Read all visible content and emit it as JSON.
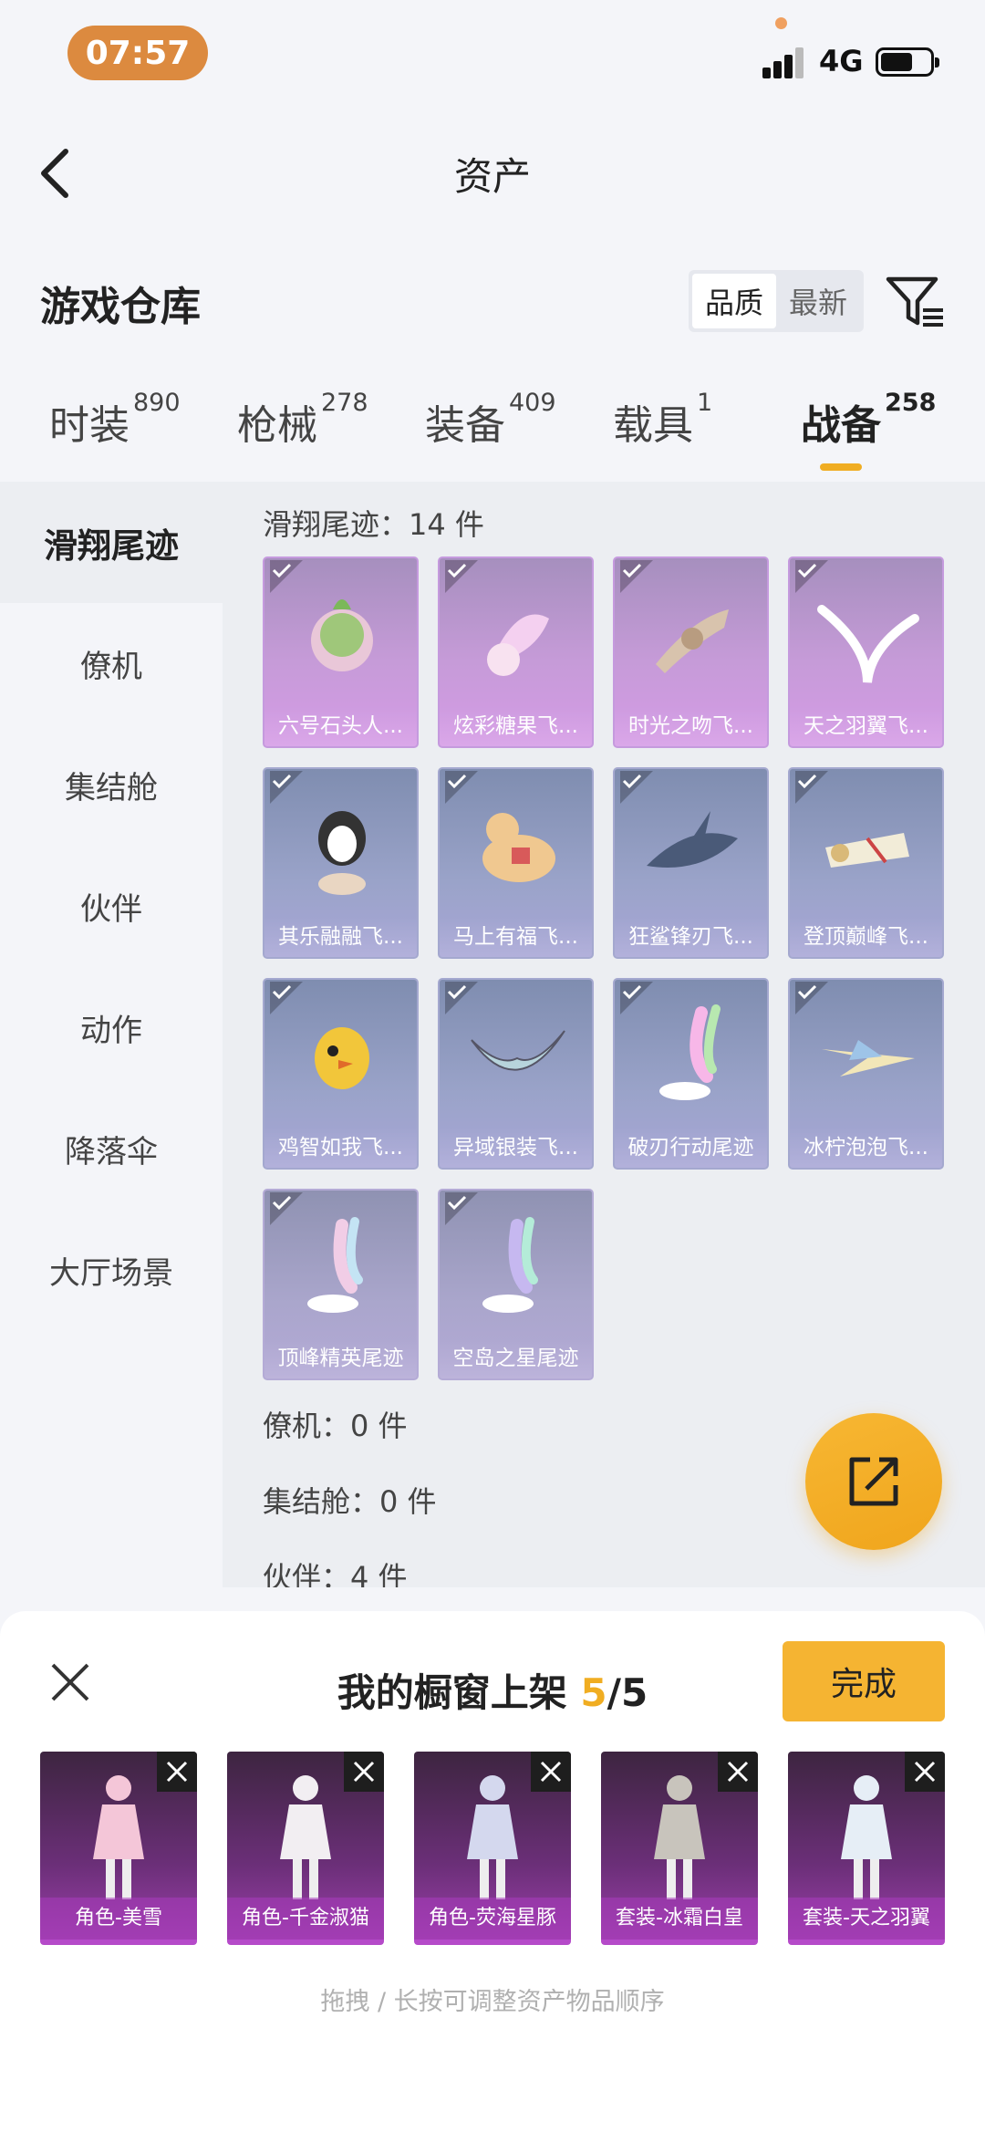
{
  "status": {
    "time": "07:57",
    "network": "4G"
  },
  "header": {
    "title": "资产"
  },
  "section": {
    "title": "游戏仓库",
    "sort_options": [
      "品质",
      "最新"
    ],
    "sort_active": 0
  },
  "tabs": [
    {
      "label": "时装",
      "count": "890"
    },
    {
      "label": "枪械",
      "count": "278"
    },
    {
      "label": "装备",
      "count": "409"
    },
    {
      "label": "载具",
      "count": "1"
    },
    {
      "label": "战备",
      "count": "258"
    }
  ],
  "active_tab": 4,
  "sidebar": {
    "items": [
      "滑翔尾迹",
      "僚机",
      "集结舱",
      "伙伴",
      "动作",
      "降落伞",
      "大厅场景"
    ],
    "active": 0
  },
  "groups": [
    {
      "title": "滑翔尾迹：14 件"
    },
    {
      "title": "僚机：0 件"
    },
    {
      "title": "集结舱：0 件"
    },
    {
      "title": "伙伴：4 件"
    }
  ],
  "items": [
    {
      "name": "六号石头人...",
      "tier": "purple"
    },
    {
      "name": "炫彩糖果飞...",
      "tier": "purple"
    },
    {
      "name": "时光之吻飞...",
      "tier": "purple"
    },
    {
      "name": "天之羽翼飞...",
      "tier": "purple"
    },
    {
      "name": "其乐融融飞...",
      "tier": "blue"
    },
    {
      "name": "马上有福飞...",
      "tier": "blue"
    },
    {
      "name": "狂鲨锋刃飞...",
      "tier": "blue"
    },
    {
      "name": "登顶巅峰飞...",
      "tier": "blue"
    },
    {
      "name": "鸡智如我飞...",
      "tier": "blue"
    },
    {
      "name": "异域银装飞...",
      "tier": "blue"
    },
    {
      "name": "破刃行动尾迹",
      "tier": "blue"
    },
    {
      "name": "冰柠泡泡飞...",
      "tier": "blue"
    },
    {
      "name": "顶峰精英尾迹",
      "tier": "muted"
    },
    {
      "name": "空岛之星尾迹",
      "tier": "muted"
    }
  ],
  "sheet": {
    "title": "我的橱窗上架",
    "count_current": "5",
    "count_total": "/5",
    "done_label": "完成",
    "hint": "拖拽 / 长按可调整资产物品顺序",
    "shelf": [
      "角色-美雪",
      "角色-千金淑猫",
      "角色-荧海星豚",
      "套装-冰霜白皇",
      "套装-天之羽翼"
    ]
  },
  "colors": {
    "accent": "#f0ad22",
    "time_pill": "#dc8a3f",
    "purple_tier": "#d59be6",
    "blue_tier": "#9aa3c9"
  }
}
